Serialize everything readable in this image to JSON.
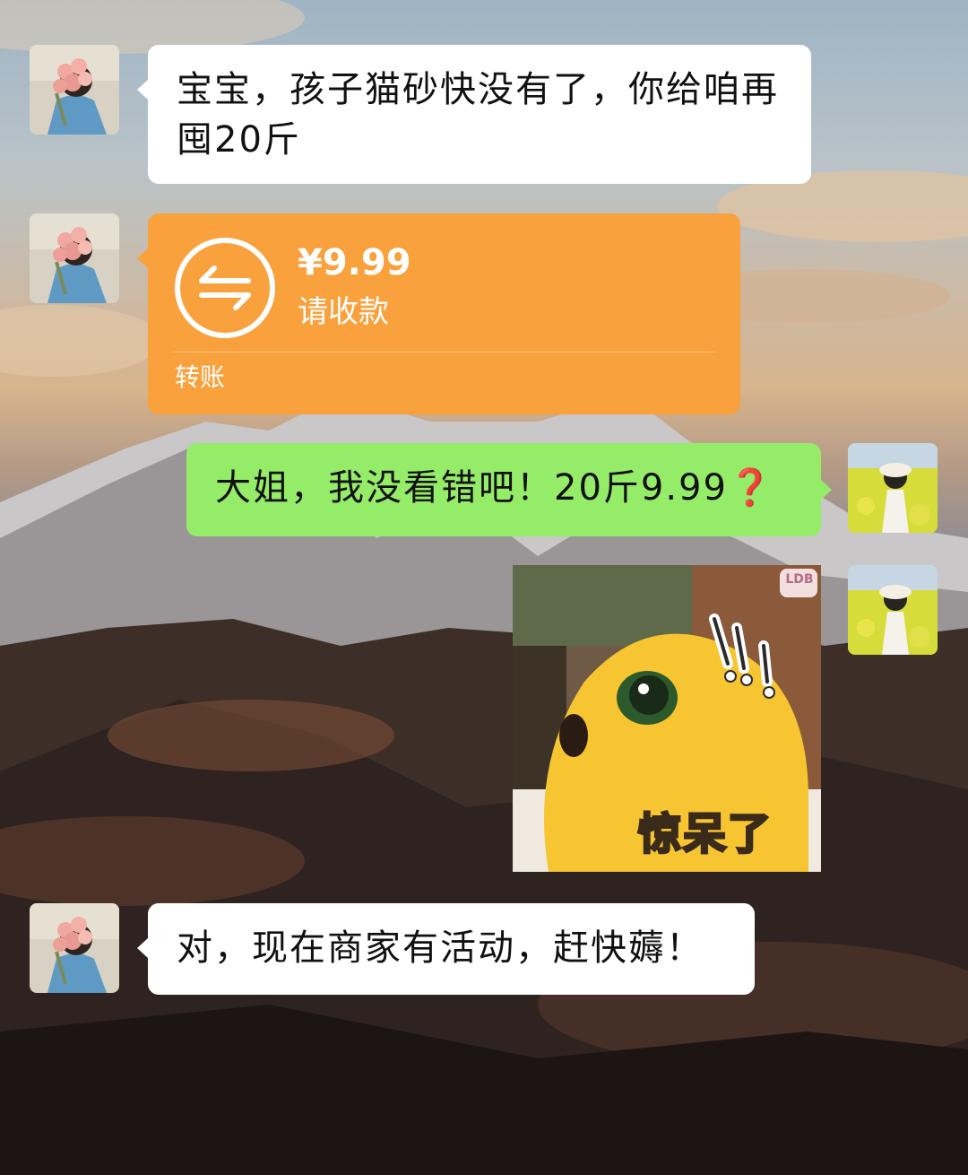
{
  "chat": {
    "messages": [
      {
        "sender": "other",
        "type": "text",
        "text": "宝宝，孩子猫砂快没有了，你给咱再囤20斤"
      },
      {
        "sender": "other",
        "type": "transfer",
        "amount": "¥9.99",
        "status": "请收款",
        "label": "转账"
      },
      {
        "sender": "self",
        "type": "text",
        "text": "大姐，我没看错吧！20斤9.99",
        "suffix": "❓"
      },
      {
        "sender": "self",
        "type": "sticker",
        "caption": "惊呆了",
        "brand": "LDB"
      },
      {
        "sender": "other",
        "type": "text",
        "text": "对，现在商家有活动，赶快薅！"
      }
    ]
  },
  "colors": {
    "bubble_other": "#ffffff",
    "bubble_self": "#95ec69",
    "transfer_card": "#f9a13c"
  },
  "icons": {
    "transfer": "transfer-arrows-icon"
  }
}
